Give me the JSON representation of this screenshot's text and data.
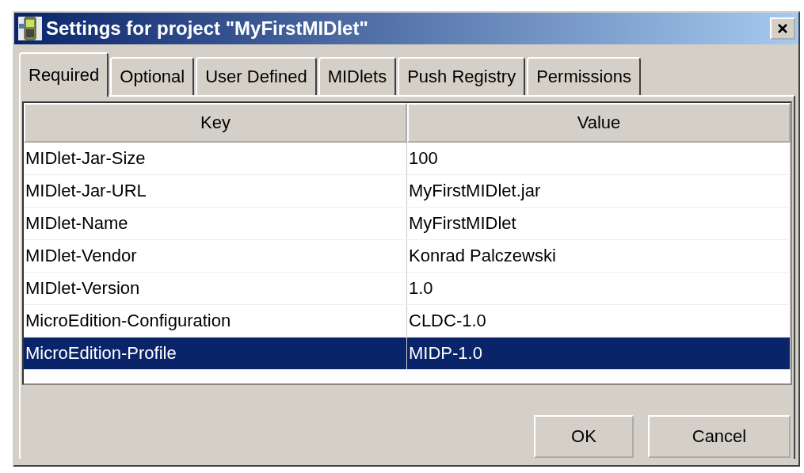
{
  "window": {
    "title": "Settings for project \"MyFirstMIDlet\""
  },
  "tabs": [
    {
      "label": "Required",
      "selected": true
    },
    {
      "label": "Optional",
      "selected": false
    },
    {
      "label": "User Defined",
      "selected": false
    },
    {
      "label": "MIDlets",
      "selected": false
    },
    {
      "label": "Push Registry",
      "selected": false
    },
    {
      "label": "Permissions",
      "selected": false
    }
  ],
  "table": {
    "columns": [
      "Key",
      "Value"
    ],
    "rows": [
      {
        "key": "MIDlet-Jar-Size",
        "value": "100",
        "selected": false
      },
      {
        "key": "MIDlet-Jar-URL",
        "value": "MyFirstMIDlet.jar",
        "selected": false
      },
      {
        "key": "MIDlet-Name",
        "value": "MyFirstMIDlet",
        "selected": false
      },
      {
        "key": "MIDlet-Vendor",
        "value": "Konrad Palczewski",
        "selected": false
      },
      {
        "key": "MIDlet-Version",
        "value": "1.0",
        "selected": false
      },
      {
        "key": "MicroEdition-Configuration",
        "value": "CLDC-1.0",
        "selected": false
      },
      {
        "key": "MicroEdition-Profile",
        "value": "MIDP-1.0",
        "selected": true
      }
    ]
  },
  "buttons": [
    "OK",
    "Cancel"
  ]
}
